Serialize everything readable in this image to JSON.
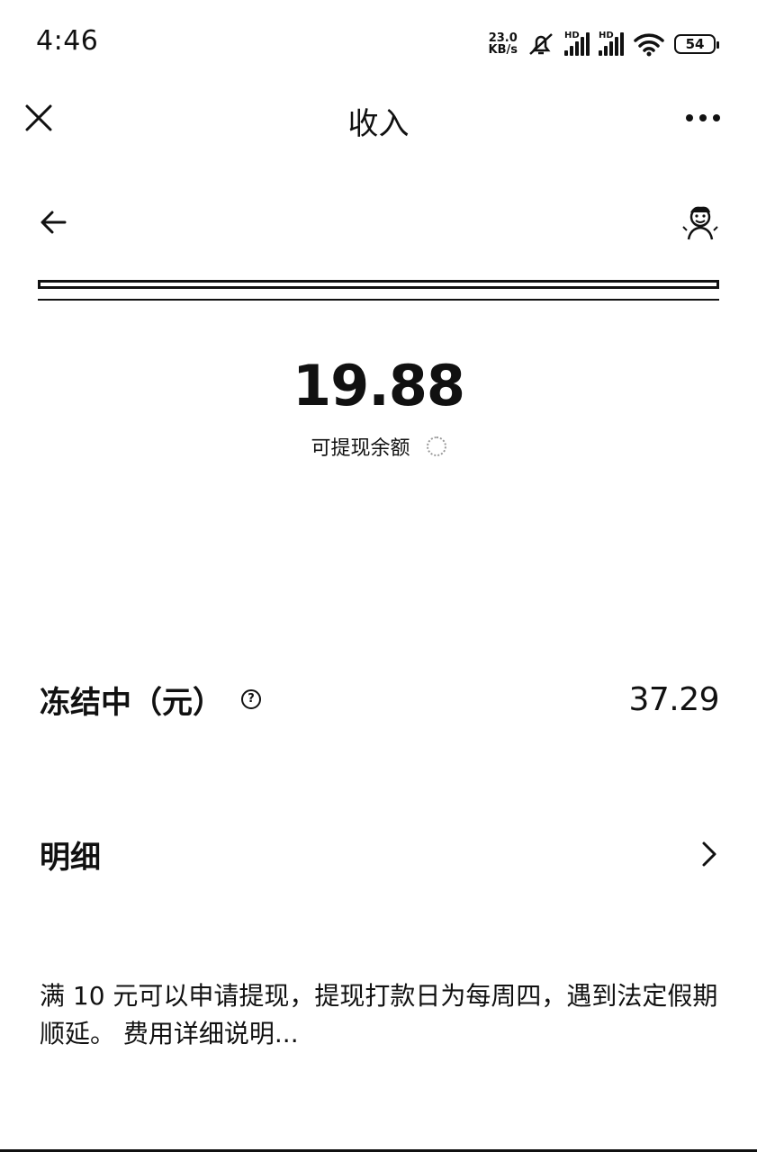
{
  "status_bar": {
    "time": "4:46",
    "net_speed_value": "23.0",
    "net_speed_unit": "KB/s",
    "hd_label_1": "HD",
    "hd_label_2": "HD",
    "battery": "54",
    "icons": [
      "mute-icon",
      "signal-icon",
      "signal-icon",
      "wifi-icon",
      "battery-icon"
    ]
  },
  "title_bar": {
    "title": "收入",
    "icons": [
      "close-icon",
      "more-icon"
    ]
  },
  "inner_nav": {
    "icons": [
      "back-arrow-icon",
      "avatar"
    ]
  },
  "balance": {
    "amount": "19.88",
    "label": "可提现余额"
  },
  "frozen": {
    "label": "冻结中（元）",
    "help_glyph": "?",
    "value": "37.29"
  },
  "detail": {
    "label": "明细"
  },
  "notice": {
    "text": "满 10 元可以申请提现，提现打款日为每周四，遇到法定假期顺延。 费用详细说明..."
  }
}
